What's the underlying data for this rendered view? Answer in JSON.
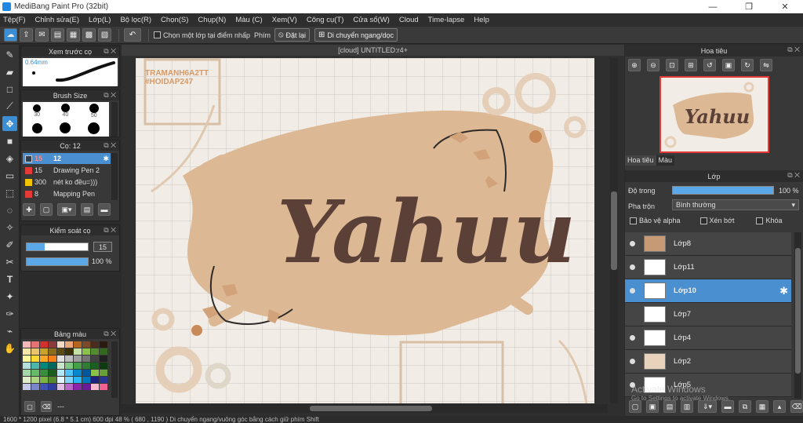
{
  "window": {
    "title": "MediBang Paint Pro (32bit)",
    "minimize": "—",
    "maximize": "❐",
    "close": "✕"
  },
  "menu": [
    "Tệp(F)",
    "Chỉnh sửa(E)",
    "Lớp(L)",
    "Bộ lọc(R)",
    "Chọn(S)",
    "Chụp(N)",
    "Màu (C)",
    "Xem(V)",
    "Công cụ(T)",
    "Cửa sổ(W)",
    "Cloud",
    "Time-lapse",
    "Help"
  ],
  "toolbar": {
    "checkbox_label": "Chọn một lớp tại điểm nhấp",
    "key_label": "Phím",
    "reset_label": "Đặt lại",
    "move_label": "Di chuyển ngang/dọc"
  },
  "brush_preview": {
    "title": "Xem trước cọ",
    "size_text": "0.64mm"
  },
  "brush_size": {
    "title": "Brush Size",
    "sizes": [
      "30",
      "40",
      "50"
    ]
  },
  "brush": {
    "title": "Cọ: 12",
    "items": [
      {
        "size": "15",
        "name": "12",
        "color": "#2c3e50"
      },
      {
        "size": "15",
        "name": "Drawing Pen 2",
        "color": "#e53935"
      },
      {
        "size": "300",
        "name": "nét ko đều=)))",
        "color": "#f2c300"
      },
      {
        "size": "8",
        "name": "Mapping Pen",
        "color": "#e53935"
      }
    ]
  },
  "brush_control": {
    "title": "Kiểm soát cọ",
    "size_value": "15",
    "opacity_value": "100 %",
    "size_fill": 0.3,
    "opacity_fill": 1.0
  },
  "palette": {
    "title": "Bảng màu",
    "footer": "---"
  },
  "canvas": {
    "tab_title": "[cloud] UNTITLED:r4+",
    "watermark_line1": "TRAMANH6A2TT",
    "watermark_line2": "#HOIDAP247",
    "art_text": "Yahuu"
  },
  "navigator": {
    "title": "Hoa tiêu",
    "tab_navigator": "Hoa tiêu",
    "tab_color": "Màu"
  },
  "layer_panel": {
    "title": "Lớp",
    "opacity_label": "Độ trong",
    "opacity_value": "100 %",
    "opacity_fill": 1.0,
    "blend_label": "Pha trộn",
    "blend_value": "Bình thường",
    "protect_alpha": "Bảo vệ alpha",
    "clipping": "Xén bớt",
    "lock": "Khóa",
    "layers": [
      {
        "name": "Lớp8",
        "visible": true,
        "selected": false
      },
      {
        "name": "Lớp11",
        "visible": true,
        "selected": false
      },
      {
        "name": "Lớp10",
        "visible": true,
        "selected": true
      },
      {
        "name": "Lớp7",
        "visible": false,
        "selected": false
      },
      {
        "name": "Lớp4",
        "visible": true,
        "selected": false
      },
      {
        "name": "Lớp2",
        "visible": true,
        "selected": false
      },
      {
        "name": "Lớp5",
        "visible": true,
        "selected": false
      }
    ]
  },
  "activation": {
    "line1": "Activate Windows",
    "line2": "Go to Settings to activate Windows."
  },
  "status": {
    "text": "1600 * 1200 pixel   (6.8 * 5.1 cm)   600 dpi   48 %   ( 680 , 1190 )   Di chuyển ngang/vuông góc bằng cách giữ phím Shift"
  },
  "colors": {
    "accent": "#3b8ed4",
    "beige": "#dcb894",
    "brown": "#5b4038"
  }
}
